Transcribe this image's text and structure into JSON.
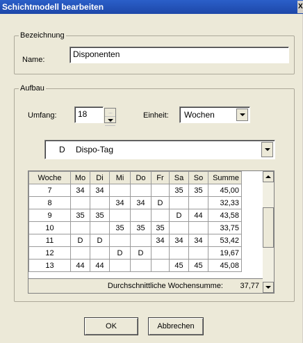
{
  "window": {
    "title": "Schichtmodell bearbeiten",
    "close_label": "X"
  },
  "bezeichnung": {
    "legend": "Bezeichnung",
    "name_label": "Name:",
    "name_value": "Disponenten"
  },
  "aufbau": {
    "legend": "Aufbau",
    "umfang_label": "Umfang:",
    "umfang_value": "18",
    "einheit_label": "Einheit:",
    "einheit_value": "Wochen",
    "dispo_code": "D",
    "dispo_value": "Dispo-Tag"
  },
  "grid": {
    "headers": [
      "Woche",
      "Mo",
      "Di",
      "Mi",
      "Do",
      "Fr",
      "Sa",
      "So",
      "Summe"
    ],
    "rows": [
      [
        "7",
        "34",
        "34",
        "",
        "",
        "",
        "35",
        "35",
        "45,00"
      ],
      [
        "8",
        "",
        "",
        "34",
        "34",
        "D",
        "",
        "",
        "32,33"
      ],
      [
        "9",
        "35",
        "35",
        "",
        "",
        "",
        "D",
        "44",
        "43,58"
      ],
      [
        "10",
        "",
        "",
        "35",
        "35",
        "35",
        "",
        "",
        "33,75"
      ],
      [
        "11",
        "D",
        "D",
        "",
        "",
        "34",
        "34",
        "34",
        "53,42"
      ],
      [
        "12",
        "",
        "",
        "D",
        "D",
        "",
        "",
        "",
        "19,67"
      ],
      [
        "13",
        "44",
        "44",
        "",
        "",
        "",
        "45",
        "45",
        "45,08"
      ]
    ],
    "footer_label": "Durchschnittliche Wochensumme:",
    "footer_value": "37,77"
  },
  "buttons": {
    "ok": "OK",
    "cancel": "Abbrechen"
  }
}
